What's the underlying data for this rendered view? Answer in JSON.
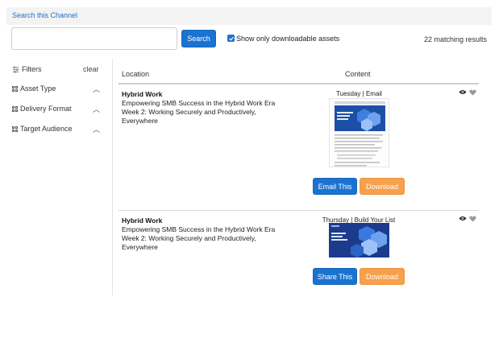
{
  "header": {
    "title": "Search this Channel"
  },
  "search": {
    "placeholder": "",
    "button_label": "Search",
    "checkbox_label": "Show only downloadable assets",
    "checkbox_checked": true,
    "results_text": "22 matching results"
  },
  "filters": {
    "title": "Filters",
    "clear_label": "clear",
    "groups": [
      {
        "label": "Asset Type",
        "caret": "︿"
      },
      {
        "label": "Delivery Format",
        "caret": "︿"
      },
      {
        "label": "Target Audience",
        "caret": "︿"
      }
    ]
  },
  "table": {
    "columns": [
      "Location",
      "Content"
    ],
    "rows": [
      {
        "title": "Hybrid Work",
        "description": "Empowering SMB Success in the Hybrid Work Era Week 2: Working Securely and Productively, Everywhere",
        "content_label": "Tuesday | Email",
        "primary_button": "Email This",
        "secondary_button": "Download"
      },
      {
        "title": "Hybrid Work",
        "description": "Empowering SMB Success in the Hybrid Work Era Week 2: Working Securely and Productively, Everywhere",
        "content_label": "Thursday | Build Your List",
        "primary_button": "Share This",
        "secondary_button": "Download"
      }
    ]
  },
  "colors": {
    "accent_blue": "#1a73d1",
    "accent_orange": "#f7a04d",
    "link_blue": "#1f6fc5"
  }
}
